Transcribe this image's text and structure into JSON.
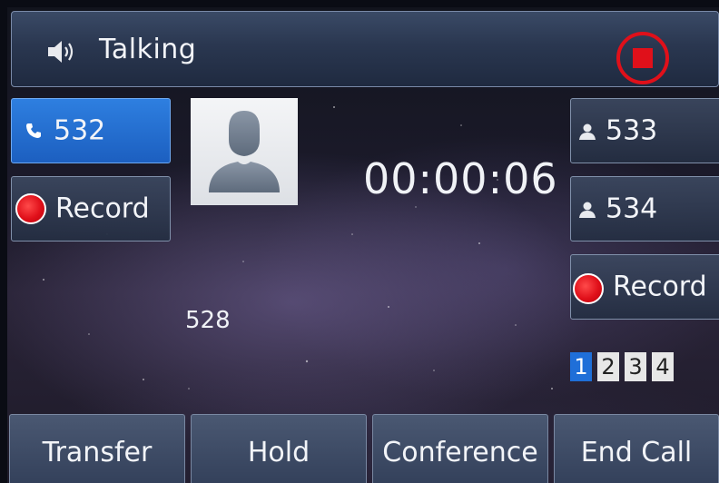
{
  "header": {
    "status_label": "Talking",
    "speaker_icon": "speaker-icon",
    "stop_icon": "stop-record-icon"
  },
  "lines": {
    "left": [
      {
        "label": "532",
        "icon": "phone-handset-icon",
        "active": true
      },
      {
        "label": "Record",
        "icon": "record-dot-icon",
        "active": false
      }
    ],
    "right": [
      {
        "label": "533",
        "icon": "contact-icon"
      },
      {
        "label": "534",
        "icon": "contact-icon"
      },
      {
        "label": "Record",
        "icon": "record-dot-icon"
      }
    ]
  },
  "call": {
    "duration": "00:00:06",
    "number": "528",
    "avatar_icon": "contact-avatar-icon"
  },
  "pagination": {
    "pages": [
      "1",
      "2",
      "3",
      "4"
    ],
    "current": "1"
  },
  "softkeys": {
    "transfer": "Transfer",
    "hold": "Hold",
    "conference": "Conference",
    "end_call": "End Call"
  },
  "colors": {
    "record_red": "#e0101a",
    "active_blue": "#2e7fe0",
    "header_bg": "#2a3750"
  }
}
